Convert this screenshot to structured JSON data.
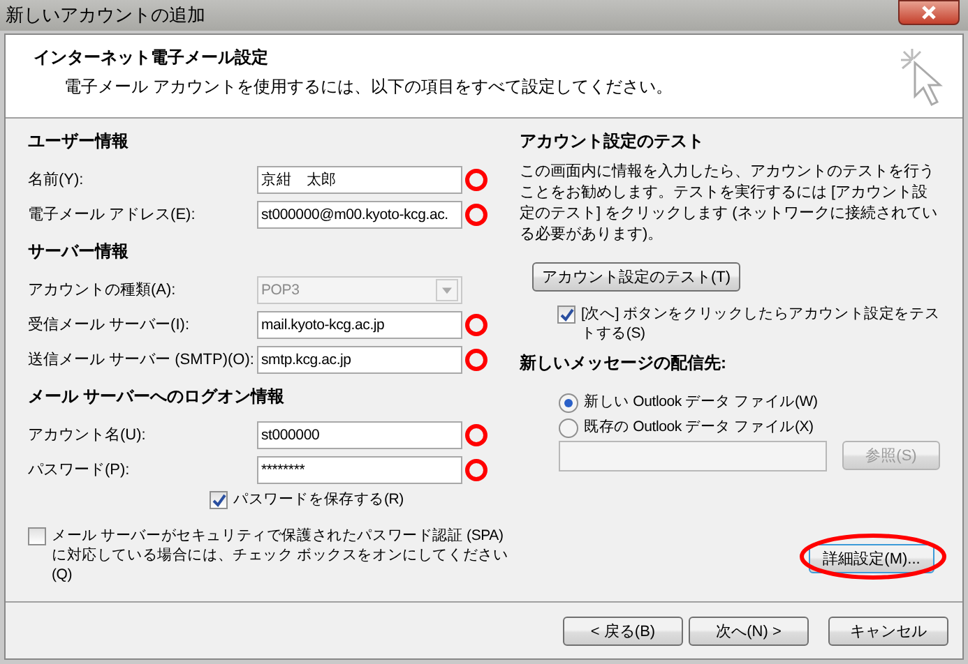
{
  "window": {
    "title": "新しいアカウントの追加"
  },
  "header": {
    "title": "インターネット電子メール設定",
    "subtitle": "電子メール アカウントを使用するには、以下の項目をすべて設定してください。"
  },
  "sections": [
    {
      "heading": "ユーザー情報",
      "fields": [
        {
          "kind": "text",
          "label": "名前(Y):",
          "value": "京紺　太郎",
          "circled": true
        },
        {
          "kind": "text",
          "label": "電子メール アドレス(E):",
          "value": "st000000@m00.kyoto-kcg.ac.",
          "circled": true
        }
      ]
    },
    {
      "heading": "サーバー情報",
      "fields": [
        {
          "kind": "dropdown",
          "label": "アカウントの種類(A):",
          "value": "POP3",
          "disabled": true
        },
        {
          "kind": "text",
          "label": "受信メール サーバー(I):",
          "value": "mail.kyoto-kcg.ac.jp",
          "circled": true
        },
        {
          "kind": "text",
          "label": "送信メール サーバー (SMTP)(O):",
          "value": "smtp.kcg.ac.jp",
          "circled": true
        }
      ]
    },
    {
      "heading": "メール サーバーへのログオン情報",
      "fields": [
        {
          "kind": "text",
          "label": "アカウント名(U):",
          "value": "st000000",
          "circled": true
        },
        {
          "kind": "text",
          "label": "パスワード(P):",
          "value": "********",
          "circled": true
        }
      ]
    }
  ],
  "save_password": {
    "label": "パスワードを保存する(R)",
    "checked": true
  },
  "spa": {
    "label": "メール サーバーがセキュリティで保護されたパスワード認証 (SPA)\nに対応している場合には、チェック ボックスをオンにしてください(Q)",
    "checked": false
  },
  "test": {
    "heading": "アカウント設定のテスト",
    "description": "この画面内に情報を入力したら、アカウントのテストを行うことをお勧めします。テストを実行するには [アカウント設定のテスト] をクリックします (ネットワークに接続されている必要があります)。",
    "button": "アカウント設定のテスト(T)",
    "on_next": {
      "label": "[次へ] ボタンをクリックしたらアカウント設定をテストする(S)",
      "checked": true
    }
  },
  "delivery": {
    "heading": "新しいメッセージの配信先:",
    "options": [
      {
        "label": "新しい Outlook データ ファイル(W)",
        "selected": true
      },
      {
        "label": "既存の Outlook データ ファイル(X)",
        "selected": false
      }
    ],
    "browse": {
      "label": "参照(S)",
      "disabled": true
    }
  },
  "advanced": {
    "label": "詳細設定(M)...",
    "circled": true
  },
  "footer": {
    "buttons": [
      "< 戻る(B)",
      "次へ(N) >",
      "キャンセル"
    ]
  }
}
